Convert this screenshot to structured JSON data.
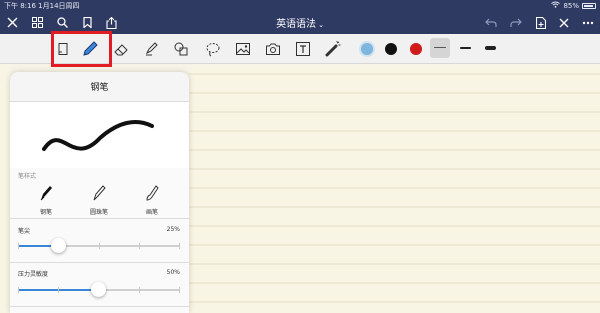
{
  "status_bar": {
    "time_date": "下午 8:16  1月14日周四",
    "battery": "85%"
  },
  "nav": {
    "title": "英语语法",
    "title_chevron": "chevron-down"
  },
  "toolbar": {
    "selected_tool": "pen",
    "colors": [
      "#7fb6e0",
      "#111111",
      "#d11a1a"
    ],
    "selected_color_index": 0,
    "thickness_options": [
      "thin",
      "medium",
      "thick"
    ],
    "selected_thickness_index": 0
  },
  "pen_panel": {
    "title": "钢笔",
    "style_section_label": "笔样式",
    "styles": [
      {
        "label": "钢笔"
      },
      {
        "label": "圆珠笔"
      },
      {
        "label": "画笔"
      }
    ],
    "selected_style_index": 0,
    "tip_label": "笔尖",
    "tip_value": "25%",
    "tip_level": 0.25,
    "pressure_label": "压力灵敏度",
    "pressure_value": "50%",
    "pressure_level": 0.5
  }
}
